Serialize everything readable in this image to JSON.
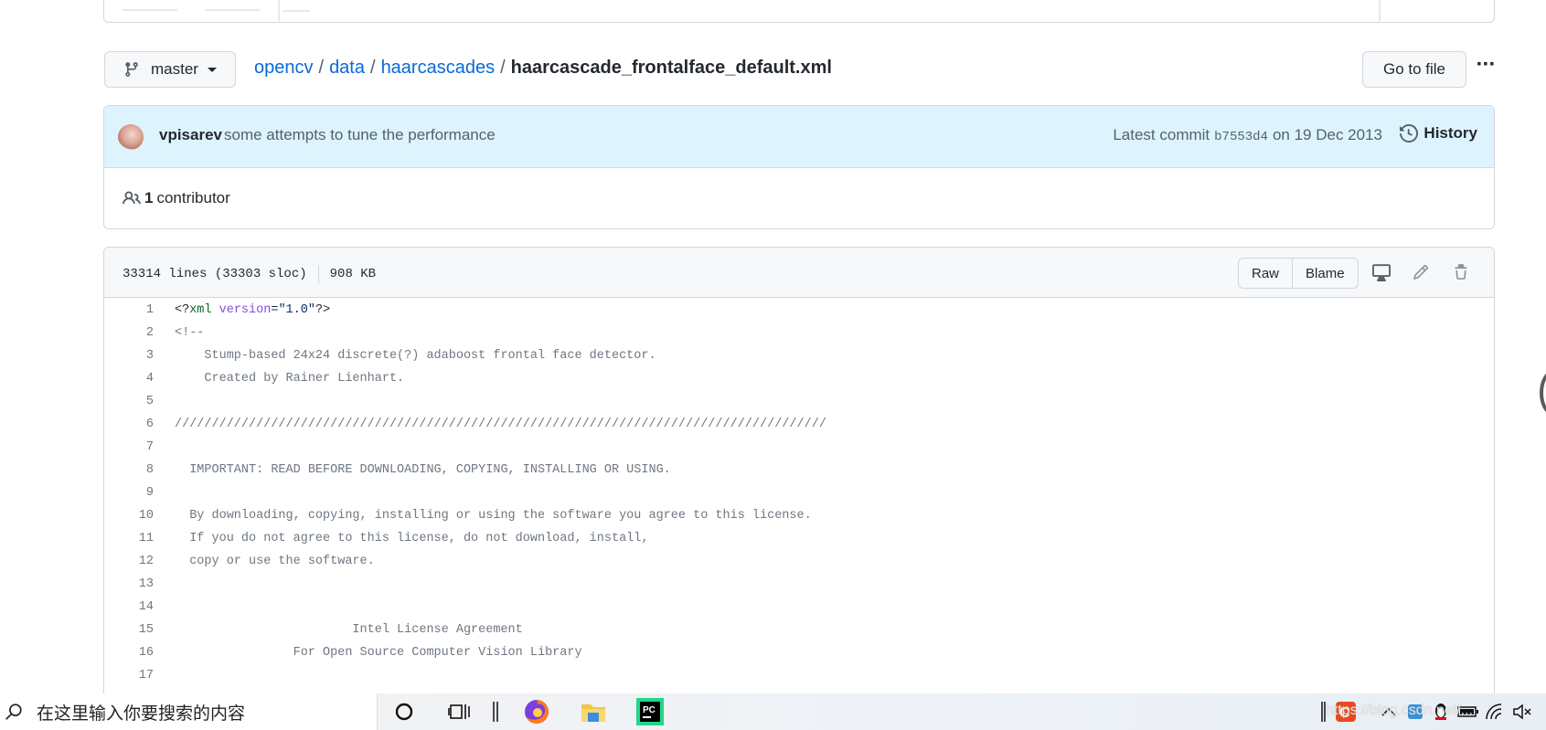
{
  "branch": {
    "label": "master"
  },
  "breadcrumb": {
    "items": [
      "opencv",
      "data",
      "haarcascades"
    ],
    "separator": "/",
    "file": "haarcascade_frontalface_default.xml"
  },
  "actions": {
    "goto_file": "Go to file",
    "more": "···"
  },
  "commit": {
    "author": "vpisarev",
    "message": "some attempts to tune the performance",
    "latest_prefix": "Latest commit",
    "sha": "b7553d4",
    "date": "on 19 Dec 2013",
    "history": "History"
  },
  "contributors": {
    "count": "1",
    "label": "contributor"
  },
  "file": {
    "lines_info": "33314 lines (33303 sloc)",
    "size": "908 KB",
    "raw": "Raw",
    "blame": "Blame"
  },
  "code_lines": [
    {
      "n": "1",
      "t": ""
    },
    {
      "n": "2",
      "t": "<!--"
    },
    {
      "n": "3",
      "t": "    Stump-based 24x24 discrete(?) adaboost frontal face detector."
    },
    {
      "n": "4",
      "t": "    Created by Rainer Lienhart."
    },
    {
      "n": "5",
      "t": ""
    },
    {
      "n": "6",
      "t": "////////////////////////////////////////////////////////////////////////////////////////"
    },
    {
      "n": "7",
      "t": ""
    },
    {
      "n": "8",
      "t": "  IMPORTANT: READ BEFORE DOWNLOADING, COPYING, INSTALLING OR USING."
    },
    {
      "n": "9",
      "t": ""
    },
    {
      "n": "10",
      "t": "  By downloading, copying, installing or using the software you agree to this license."
    },
    {
      "n": "11",
      "t": "  If you do not agree to this license, do not download, install,"
    },
    {
      "n": "12",
      "t": "  copy or use the software."
    },
    {
      "n": "13",
      "t": ""
    },
    {
      "n": "14",
      "t": ""
    },
    {
      "n": "15",
      "t": "                        Intel License Agreement"
    },
    {
      "n": "16",
      "t": "                For Open Source Computer Vision Library"
    },
    {
      "n": "17",
      "t": ""
    }
  ],
  "xml_decl": {
    "open": "<?",
    "name": "xml",
    "attr": "version",
    "eq": "=",
    "value": "\"1.0\"",
    "close": "?>"
  },
  "taskbar": {
    "search_placeholder": "在这里输入你要搜索的内容",
    "watermark": "https://blog.csdn.net/..."
  }
}
